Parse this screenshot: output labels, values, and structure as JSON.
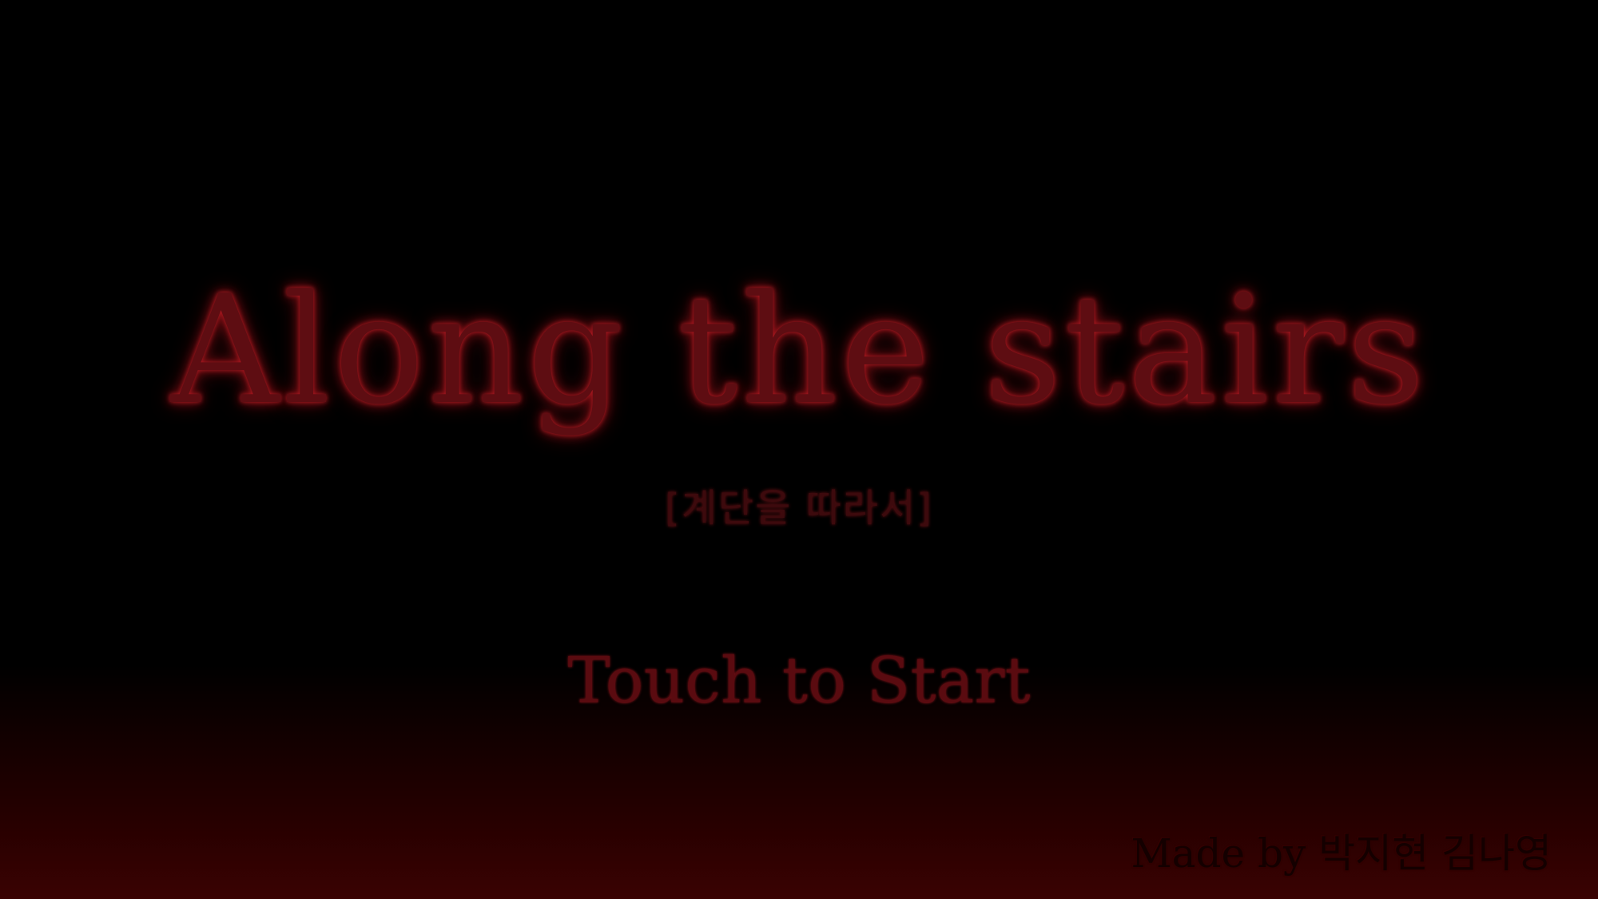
{
  "title": "Along the stairs",
  "subtitle": "[계단을 따라서]",
  "start_prompt": "Touch to Start",
  "credits": "Made by 박지현 김나영",
  "colors": {
    "background": "#000000",
    "bottom_glow": "#3a0202",
    "title_red": "#5e0d12",
    "glow_red": "#b01a22"
  }
}
